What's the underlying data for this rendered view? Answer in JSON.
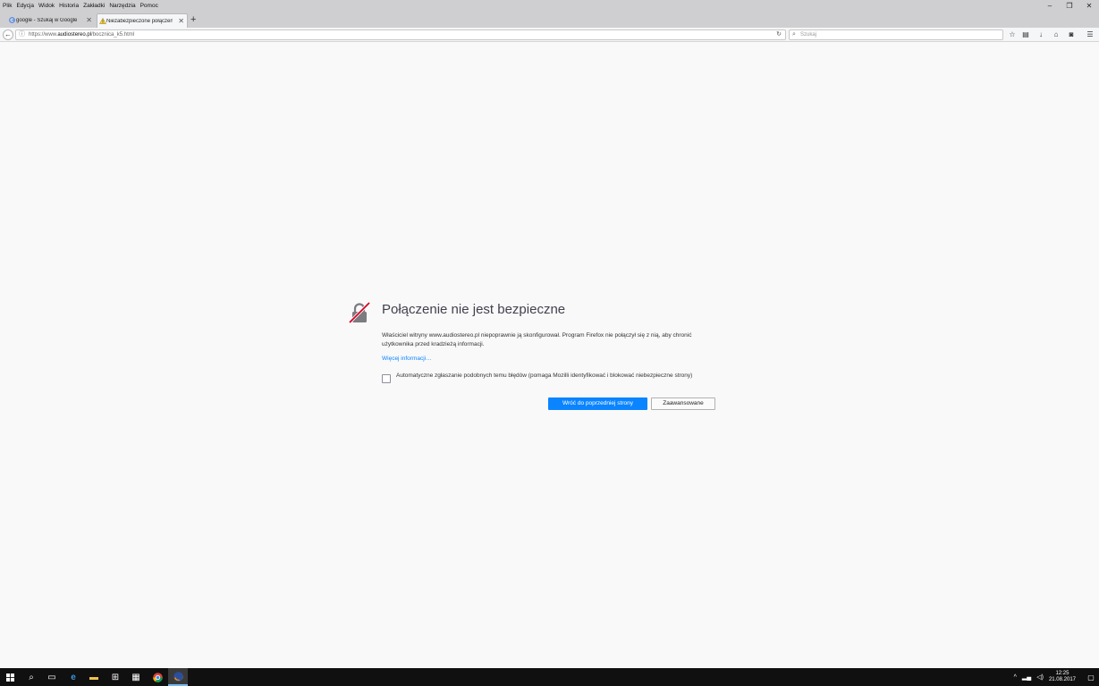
{
  "menubar": {
    "items": [
      "Plik",
      "Edycja",
      "Widok",
      "Historia",
      "Zakładki",
      "Narzędzia",
      "Pomoc"
    ]
  },
  "window_controls": {
    "minimize": "–",
    "restore": "❐",
    "close": "✕"
  },
  "tabs": [
    {
      "favicon": "google-g-icon",
      "label": "google - Szukaj w Google",
      "active": false
    },
    {
      "favicon": "warning-icon",
      "label": "Niezabezpieczone połączenie",
      "active": true
    }
  ],
  "navbar": {
    "url_prefix": "https://www.",
    "url_domain": "audiostereo.pl",
    "url_path": "/bocznica_k5.html",
    "search_placeholder": "Szukaj"
  },
  "error_page": {
    "title": "Połączenie nie jest bezpieczne",
    "description": "Właściciel witryny www.audiostereo.pl niepoprawnie ją skonfigurował. Program Firefox nie połączył się z nią, aby chronić użytkownika przed kradzieżą informacji.",
    "learn_more": "Więcej informacji…",
    "report_label": "Automatyczne zgłaszanie podobnych temu błędów (pomaga Mozilli identyfikować i blokować niebezpieczne strony)",
    "report_checked": false,
    "back_button": "Wróć do poprzedniej strony",
    "advanced_button": "Zaawansowane",
    "accent_color": "#0a84ff"
  },
  "taskbar": {
    "time": "12:25",
    "date": "21.08.2017"
  }
}
